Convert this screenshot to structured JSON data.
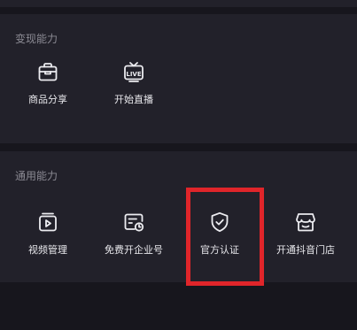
{
  "sections": {
    "monetize": {
      "title": "变现能力",
      "items": [
        {
          "label": "商品分享",
          "icon": "shopping-bag-icon"
        },
        {
          "label": "开始直播",
          "icon": "live-tv-icon"
        }
      ]
    },
    "general": {
      "title": "通用能力",
      "items": [
        {
          "label": "视频管理",
          "icon": "video-manage-icon"
        },
        {
          "label": "免费开企业号",
          "icon": "business-card-clock-icon"
        },
        {
          "label": "官方认证",
          "icon": "shield-check-icon"
        },
        {
          "label": "开通抖音门店",
          "icon": "storefront-icon"
        }
      ]
    }
  },
  "highlight": {
    "color": "#e0252a"
  }
}
